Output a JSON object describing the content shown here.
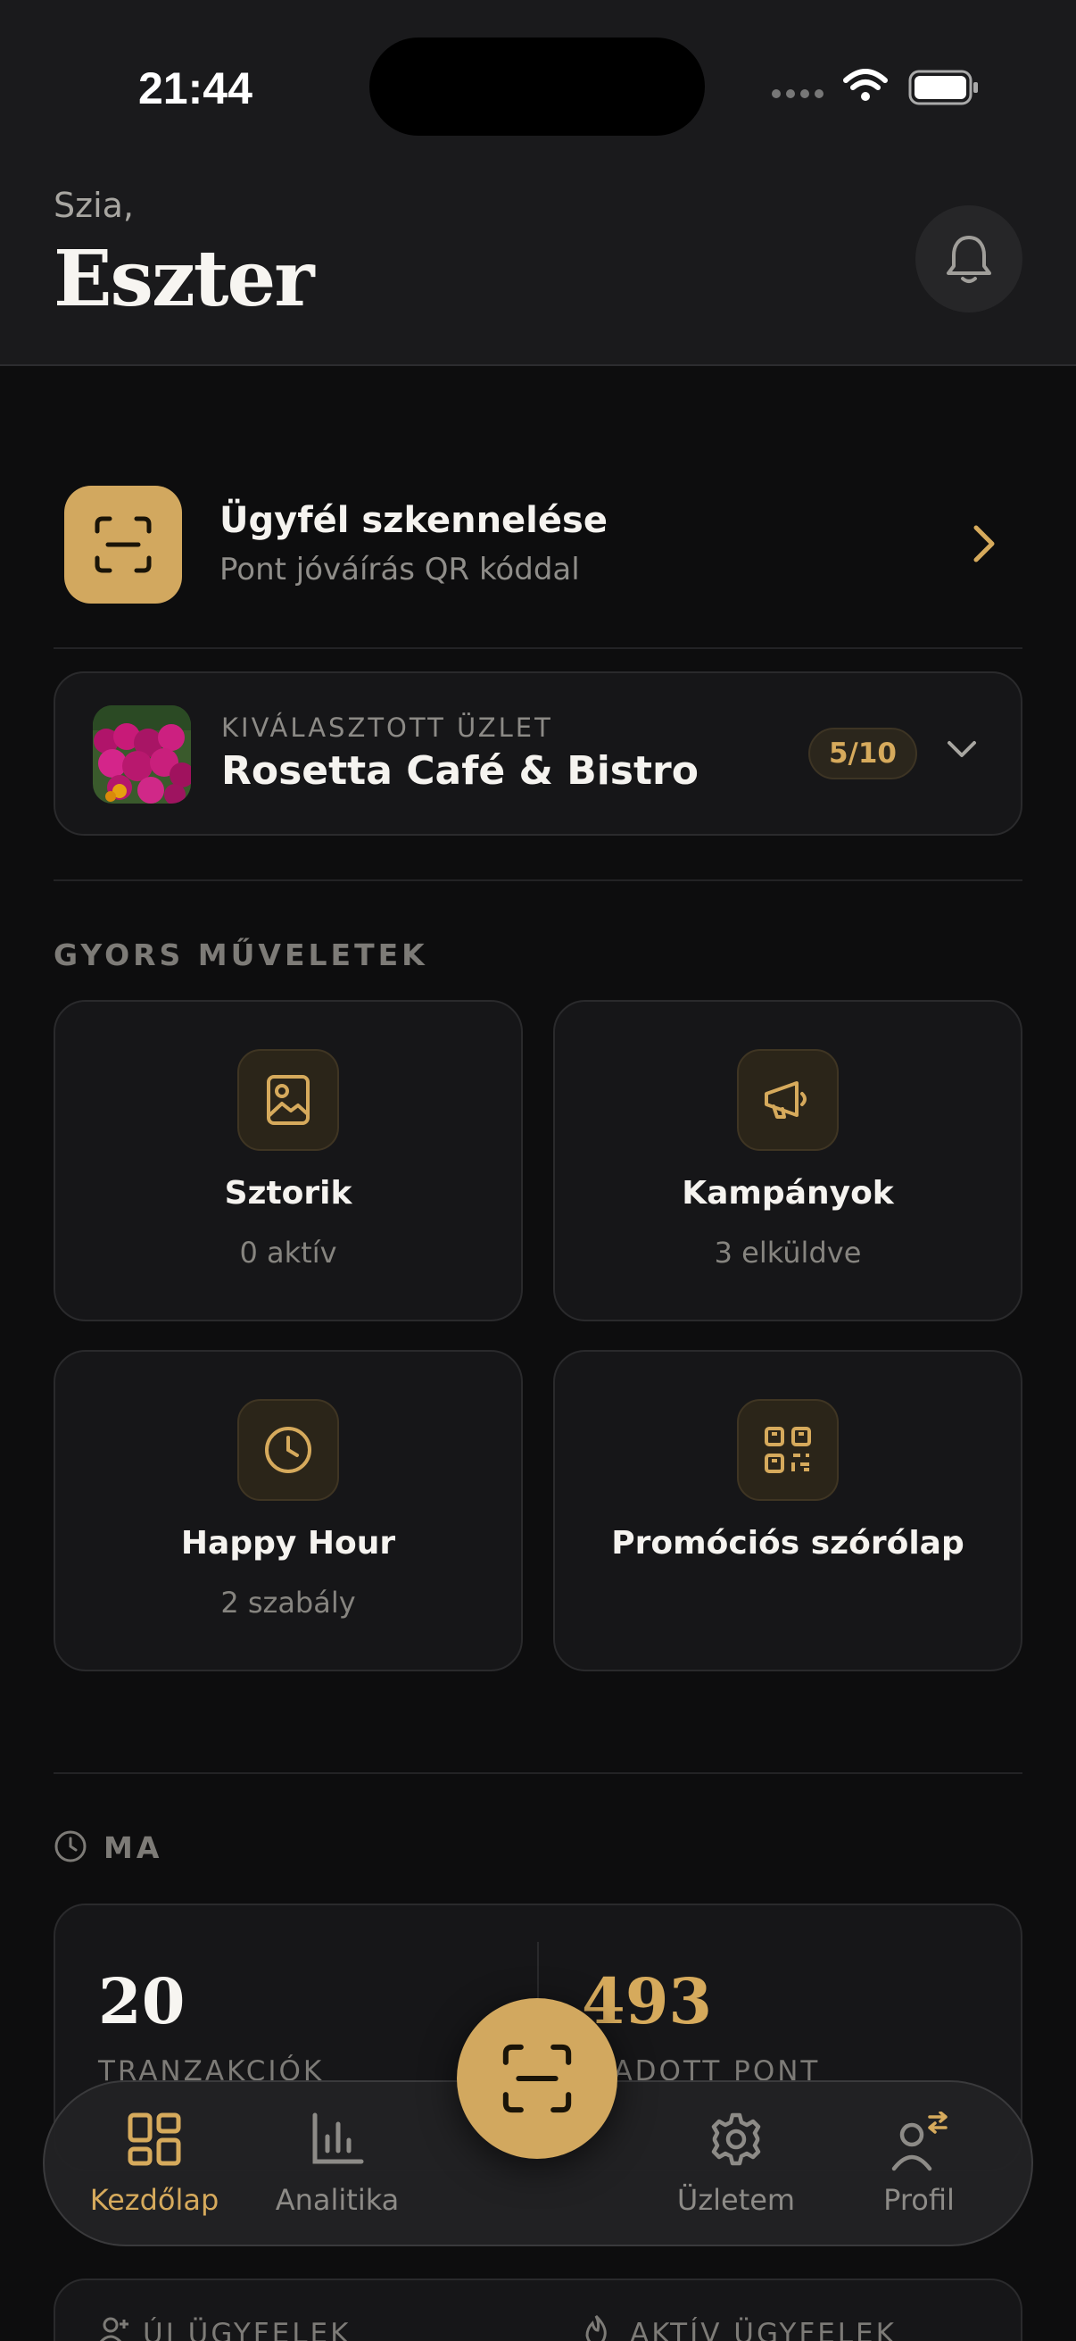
{
  "status_bar": {
    "time": "21:44"
  },
  "header": {
    "greeting": "Szia,",
    "name": "Eszter"
  },
  "scan": {
    "title": "Ügyfél szkennelése",
    "subtitle": "Pont jóváírás QR kóddal"
  },
  "store": {
    "label": "KIVÁLASZTOTT ÜZLET",
    "name": "Rosetta Café & Bistro",
    "badge": "5/10"
  },
  "quick_actions": {
    "label": "GYORS MŰVELETEK",
    "items": [
      {
        "title": "Sztorik",
        "subtitle": "0 aktív",
        "icon": "image-icon"
      },
      {
        "title": "Kampányok",
        "subtitle": "3 elküldve",
        "icon": "megaphone-icon"
      },
      {
        "title": "Happy Hour",
        "subtitle": "2 szabály",
        "icon": "clock-icon"
      },
      {
        "title": "Promóciós szórólap",
        "subtitle": "",
        "icon": "qr-code-icon"
      }
    ]
  },
  "today": {
    "label": "MA",
    "stats": [
      {
        "value": "20",
        "label": "TRANZAKCIÓK"
      },
      {
        "value": "493",
        "label": "KIADOTT PONT"
      }
    ]
  },
  "customers": {
    "new_label": "ÚJ ÜGYFELEK",
    "active_label": "AKTÍV ÜGYFELEK"
  },
  "tabbar": {
    "items": [
      {
        "label": "Kezdőlap",
        "icon": "grid-icon",
        "active": true
      },
      {
        "label": "Analitika",
        "icon": "bar-chart-icon",
        "active": false
      },
      {
        "label": "Üzletem",
        "icon": "gear-icon",
        "active": false
      },
      {
        "label": "Profil",
        "icon": "user-switch-icon",
        "active": false
      }
    ]
  },
  "colors": {
    "accent": "#d2a85f",
    "background": "#0d0d0e",
    "card": "#161618"
  }
}
